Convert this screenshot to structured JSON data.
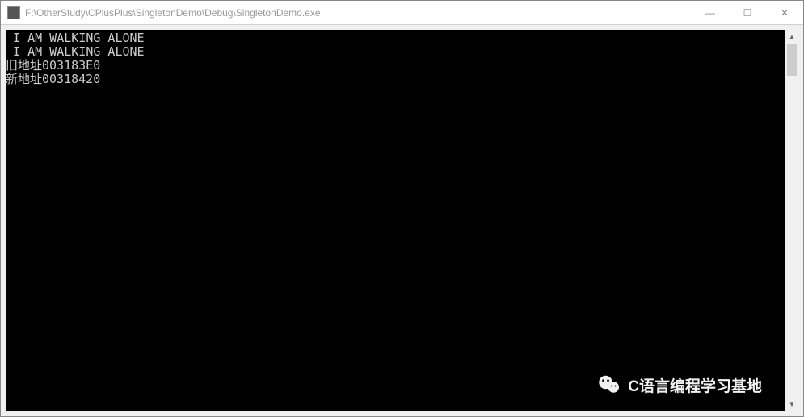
{
  "window": {
    "title": "F:\\OtherStudy\\CPlusPlus\\SingletonDemo\\Debug\\SingletonDemo.exe"
  },
  "controls": {
    "minimize": "—",
    "maximize": "☐",
    "close": "✕"
  },
  "console": {
    "lines": [
      " I AM WALKING ALONE",
      " I AM WALKING ALONE",
      "旧地址003183E0",
      "新地址00318420"
    ]
  },
  "scrollbar": {
    "up": "▲",
    "down": "▼"
  },
  "watermark": {
    "text": "C语言编程学习基地"
  }
}
